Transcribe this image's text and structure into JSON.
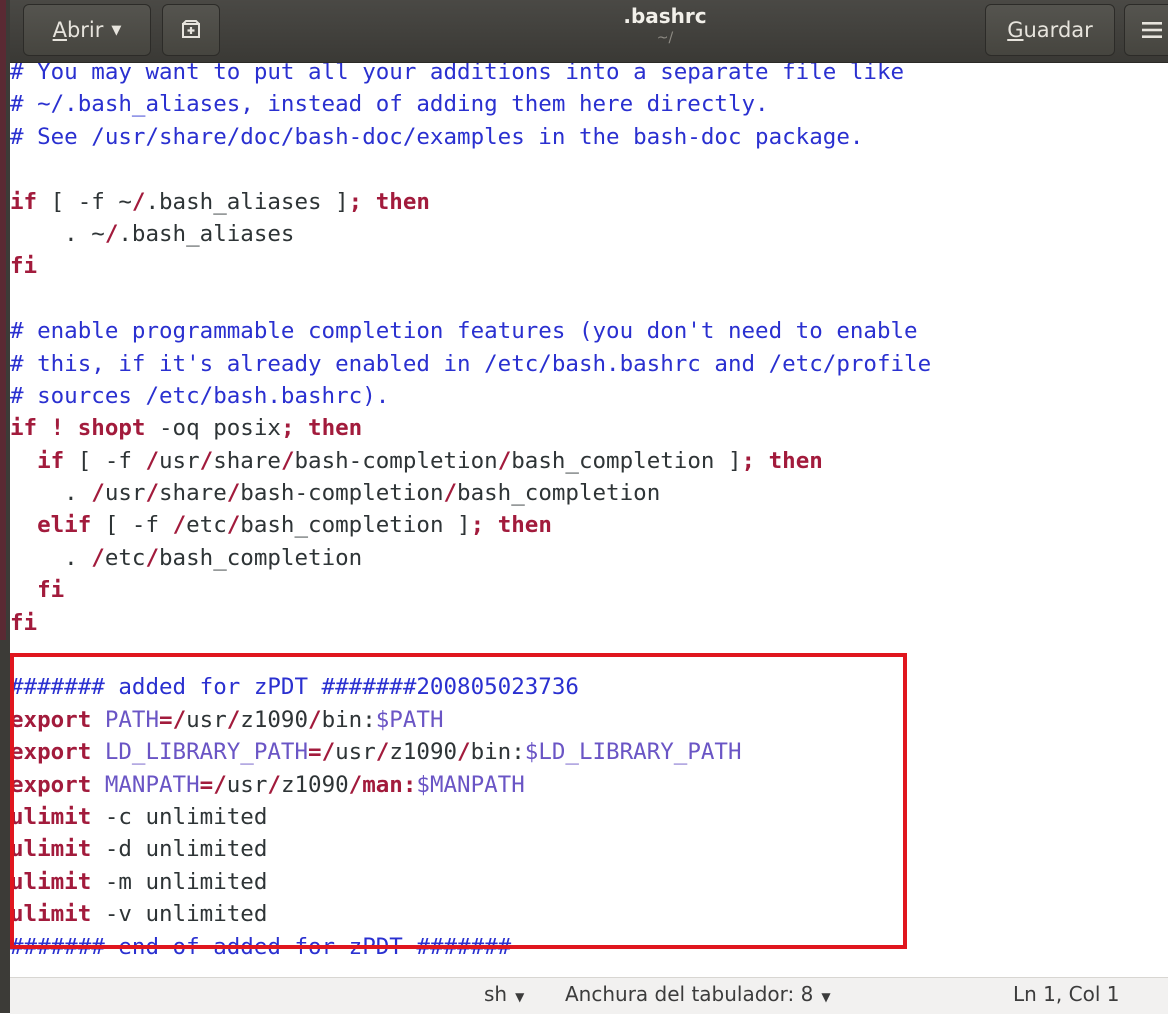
{
  "window": {
    "title": ".bashrc",
    "subtitle": "~/"
  },
  "headerbar": {
    "open_label": "Abrir",
    "open_mnemonic": "A",
    "open_rest": "brir",
    "new_tab_icon": "new-tab-icon",
    "save_label": "Guardar",
    "save_mnemonic": "G",
    "save_rest": "uardar",
    "menu_icon": "hamburger-menu-icon"
  },
  "editor": {
    "highlight_color": "#e0161e",
    "lines": [
      [
        {
          "t": "# You may want to put all your additions into a separate file like",
          "s": "com"
        }
      ],
      [
        {
          "t": "# ~/.bash_aliases, instead of adding them here directly.",
          "s": "com"
        }
      ],
      [
        {
          "t": "# See /usr/share/doc/bash-doc/examples in the bash-doc package.",
          "s": "com"
        }
      ],
      [],
      [
        {
          "t": "if",
          "s": "kw"
        },
        {
          "t": " [ -f ~",
          "s": "txt"
        },
        {
          "t": "/",
          "s": "op"
        },
        {
          "t": ".bash_aliases ]",
          "s": "txt"
        },
        {
          "t": ";",
          "s": "op"
        },
        {
          "t": " ",
          "s": "txt"
        },
        {
          "t": "then",
          "s": "kw"
        }
      ],
      [
        {
          "t": "    . ~",
          "s": "txt"
        },
        {
          "t": "/",
          "s": "op"
        },
        {
          "t": ".bash_aliases",
          "s": "txt"
        }
      ],
      [
        {
          "t": "fi",
          "s": "kw"
        }
      ],
      [],
      [
        {
          "t": "# enable programmable completion features (you don't need to enable",
          "s": "com"
        }
      ],
      [
        {
          "t": "# this, if it's already enabled in /etc/bash.bashrc and /etc/profile",
          "s": "com"
        }
      ],
      [
        {
          "t": "# sources /etc/bash.bashrc).",
          "s": "com"
        }
      ],
      [
        {
          "t": "if",
          "s": "kw"
        },
        {
          "t": " ",
          "s": "txt"
        },
        {
          "t": "!",
          "s": "kw"
        },
        {
          "t": " ",
          "s": "txt"
        },
        {
          "t": "shopt",
          "s": "kw"
        },
        {
          "t": " -oq posix",
          "s": "txt"
        },
        {
          "t": ";",
          "s": "op"
        },
        {
          "t": " ",
          "s": "txt"
        },
        {
          "t": "then",
          "s": "kw"
        }
      ],
      [
        {
          "t": "  ",
          "s": "txt"
        },
        {
          "t": "if",
          "s": "kw"
        },
        {
          "t": " [ -f ",
          "s": "txt"
        },
        {
          "t": "/",
          "s": "op"
        },
        {
          "t": "usr",
          "s": "txt"
        },
        {
          "t": "/",
          "s": "op"
        },
        {
          "t": "share",
          "s": "txt"
        },
        {
          "t": "/",
          "s": "op"
        },
        {
          "t": "bash-completion",
          "s": "txt"
        },
        {
          "t": "/",
          "s": "op"
        },
        {
          "t": "bash_completion ]",
          "s": "txt"
        },
        {
          "t": ";",
          "s": "op"
        },
        {
          "t": " ",
          "s": "txt"
        },
        {
          "t": "then",
          "s": "kw"
        }
      ],
      [
        {
          "t": "    . ",
          "s": "txt"
        },
        {
          "t": "/",
          "s": "op"
        },
        {
          "t": "usr",
          "s": "txt"
        },
        {
          "t": "/",
          "s": "op"
        },
        {
          "t": "share",
          "s": "txt"
        },
        {
          "t": "/",
          "s": "op"
        },
        {
          "t": "bash-completion",
          "s": "txt"
        },
        {
          "t": "/",
          "s": "op"
        },
        {
          "t": "bash_completion",
          "s": "txt"
        }
      ],
      [
        {
          "t": "  ",
          "s": "txt"
        },
        {
          "t": "elif",
          "s": "kw"
        },
        {
          "t": " [ -f ",
          "s": "txt"
        },
        {
          "t": "/",
          "s": "op"
        },
        {
          "t": "etc",
          "s": "txt"
        },
        {
          "t": "/",
          "s": "op"
        },
        {
          "t": "bash_completion ]",
          "s": "txt"
        },
        {
          "t": ";",
          "s": "op"
        },
        {
          "t": " ",
          "s": "txt"
        },
        {
          "t": "then",
          "s": "kw"
        }
      ],
      [
        {
          "t": "    . ",
          "s": "txt"
        },
        {
          "t": "/",
          "s": "op"
        },
        {
          "t": "etc",
          "s": "txt"
        },
        {
          "t": "/",
          "s": "op"
        },
        {
          "t": "bash_completion",
          "s": "txt"
        }
      ],
      [
        {
          "t": "  ",
          "s": "txt"
        },
        {
          "t": "fi",
          "s": "kw"
        }
      ],
      [
        {
          "t": "fi",
          "s": "kw"
        }
      ],
      [],
      [
        {
          "t": "####### added for zPDT #######200805023736",
          "s": "com"
        }
      ],
      [
        {
          "t": "export",
          "s": "kw"
        },
        {
          "t": " ",
          "s": "txt"
        },
        {
          "t": "PATH",
          "s": "var"
        },
        {
          "t": "=",
          "s": "op"
        },
        {
          "t": "/",
          "s": "op"
        },
        {
          "t": "usr",
          "s": "txt"
        },
        {
          "t": "/",
          "s": "op"
        },
        {
          "t": "z1090",
          "s": "txt"
        },
        {
          "t": "/",
          "s": "op"
        },
        {
          "t": "bin:",
          "s": "txt"
        },
        {
          "t": "$PATH",
          "s": "var"
        }
      ],
      [
        {
          "t": "export",
          "s": "kw"
        },
        {
          "t": " ",
          "s": "txt"
        },
        {
          "t": "LD_LIBRARY_PATH",
          "s": "var"
        },
        {
          "t": "=",
          "s": "op"
        },
        {
          "t": "/",
          "s": "op"
        },
        {
          "t": "usr",
          "s": "txt"
        },
        {
          "t": "/",
          "s": "op"
        },
        {
          "t": "z1090",
          "s": "txt"
        },
        {
          "t": "/",
          "s": "op"
        },
        {
          "t": "bin:",
          "s": "txt"
        },
        {
          "t": "$LD_LIBRARY_PATH",
          "s": "var"
        }
      ],
      [
        {
          "t": "export",
          "s": "kw"
        },
        {
          "t": " ",
          "s": "txt"
        },
        {
          "t": "MANPATH",
          "s": "var"
        },
        {
          "t": "=",
          "s": "op"
        },
        {
          "t": "/",
          "s": "op"
        },
        {
          "t": "usr",
          "s": "txt"
        },
        {
          "t": "/",
          "s": "op"
        },
        {
          "t": "z1090",
          "s": "txt"
        },
        {
          "t": "/",
          "s": "op"
        },
        {
          "t": "man:",
          "s": "kw"
        },
        {
          "t": "$MANPATH",
          "s": "var"
        }
      ],
      [
        {
          "t": "ulimit",
          "s": "kw"
        },
        {
          "t": " -c unlimited",
          "s": "txt"
        }
      ],
      [
        {
          "t": "ulimit",
          "s": "kw"
        },
        {
          "t": " -d unlimited",
          "s": "txt"
        }
      ],
      [
        {
          "t": "ulimit",
          "s": "kw"
        },
        {
          "t": " -m unlimited",
          "s": "txt"
        }
      ],
      [
        {
          "t": "ulimit",
          "s": "kw"
        },
        {
          "t": " -v unlimited",
          "s": "txt"
        }
      ],
      [
        {
          "t": "####### end of added for zPDT #######",
          "s": "com"
        }
      ]
    ]
  },
  "statusbar": {
    "language": "sh",
    "tab_width": "Anchura del tabulador: 8",
    "position": "Ln 1, Col 1"
  }
}
